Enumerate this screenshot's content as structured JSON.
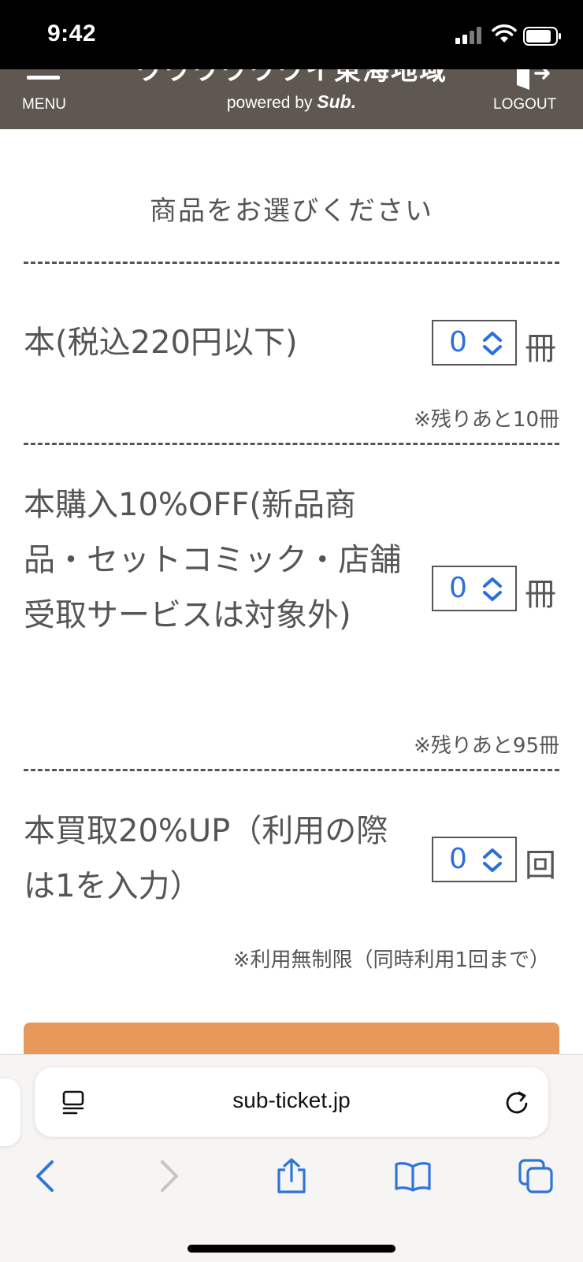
{
  "status_bar": {
    "time": "9:42"
  },
  "header": {
    "menu_label": "MENU",
    "powered_prefix": "powered by ",
    "powered_brand": "Sub.",
    "logout_label": "LOGOUT"
  },
  "main": {
    "heading": "商品をお選びください",
    "products": [
      {
        "name": "本(税込220円以下)",
        "quantity": "0",
        "unit": "冊",
        "note": "※残りあと10冊"
      },
      {
        "name": "本購入10%OFF(新品商品・セットコミック・店舗受取サービスは対象外)",
        "quantity": "0",
        "unit": "冊",
        "note": "※残りあと95冊"
      },
      {
        "name": "本買取20%UP（利用の際は1を入力）",
        "quantity": "0",
        "unit": "回",
        "note": "※利用無制限（同時利用1回まで）"
      }
    ]
  },
  "browser": {
    "address": "sub-ticket.jp"
  },
  "colors": {
    "header_bg": "#5e5850",
    "accent": "#e8995a",
    "link_blue": "#2a6fdb"
  }
}
